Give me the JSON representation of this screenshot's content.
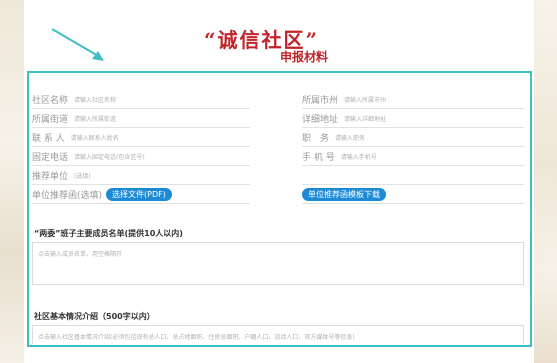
{
  "title": {
    "main": "“诚信社区”",
    "sub": "申报材料"
  },
  "colors": {
    "accent": "#3dbfc4",
    "title": "#c0242a",
    "button": "#1e8ad6"
  },
  "left_fields": [
    {
      "label": "社区名称",
      "placeholder": "请输入社区名称"
    },
    {
      "label": "所属街道",
      "placeholder": "请输入所属街道"
    },
    {
      "label": "联 系 人",
      "placeholder": "请输入联系人姓名"
    },
    {
      "label": "固定电话",
      "placeholder": "请输入固定电话(包含区号)"
    },
    {
      "label": "推荐单位",
      "placeholder": "(选填)"
    }
  ],
  "right_fields": [
    {
      "label": "所属市州",
      "placeholder": "请输入所属市州"
    },
    {
      "label": "详细地址",
      "placeholder": "请输入详细地址"
    },
    {
      "label": "职　务",
      "placeholder": "请输入职务"
    },
    {
      "label": "手 机 号",
      "placeholder": "请输入手机号"
    }
  ],
  "upload": {
    "label": "单位推荐函(选填)",
    "button": "选择文件(PDF)",
    "download": "单位推荐函模板下载"
  },
  "members": {
    "title": "“两委”班子主要成员名单(提供10人以内)",
    "placeholder": "点击输入成员名单，用空格隔开"
  },
  "intro": {
    "title": "社区基本情况介绍（500字以内）",
    "placeholder": "点击输入社区基本情况介绍(必须包括现有总人口、总占地面积、住房总面积、户籍人口、流动人口、官方媒体号等信息)"
  }
}
